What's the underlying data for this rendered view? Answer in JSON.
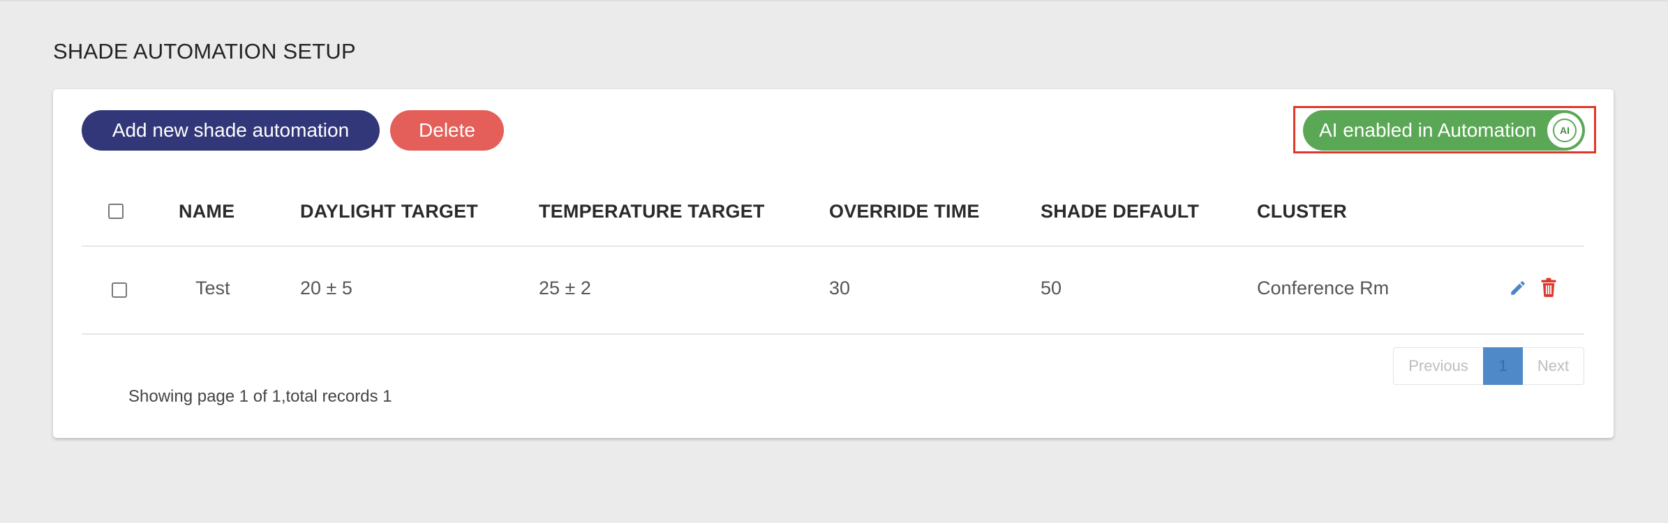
{
  "page": {
    "title": "SHADE AUTOMATION SETUP"
  },
  "toolbar": {
    "add_label": "Add new shade automation",
    "delete_label": "Delete",
    "ai_toggle_label": "AI enabled in Automation",
    "ai_badge_text": "AI",
    "ai_toggle_on": true
  },
  "table": {
    "columns": [
      "NAME",
      "DAYLIGHT TARGET",
      "TEMPERATURE TARGET",
      "OVERRIDE TIME",
      "SHADE DEFAULT",
      "CLUSTER"
    ],
    "rows": [
      {
        "name": "Test",
        "daylight_target": "20 ± 5",
        "temperature_target": "25 ± 2",
        "override_time": "30",
        "shade_default": "50",
        "cluster": "Conference Rm"
      }
    ]
  },
  "pagination": {
    "previous": "Previous",
    "current": "1",
    "next": "Next"
  },
  "footer": {
    "summary": "Showing page 1 of 1,total records 1"
  },
  "colors": {
    "primary": "#323779",
    "danger": "#e45f59",
    "ai_toggle": "#5aa755",
    "highlight_frame": "#e0362b",
    "edit_icon": "#4a86c5",
    "page_active": "#4f89c8"
  }
}
